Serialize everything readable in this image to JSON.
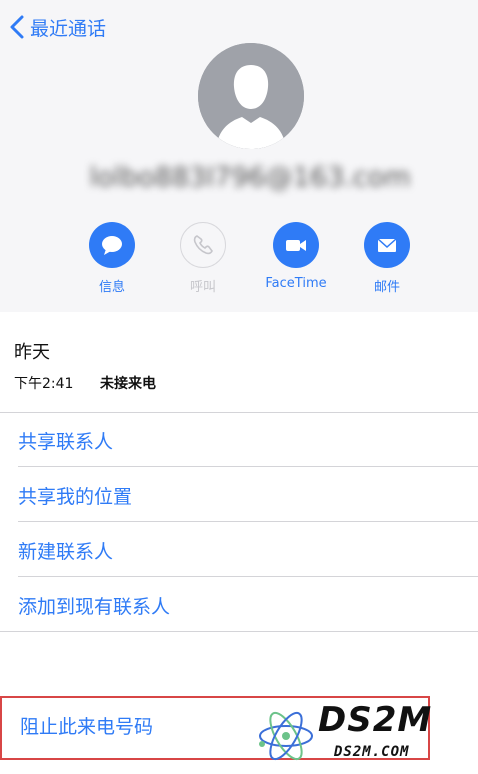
{
  "nav": {
    "back_label": "最近通话"
  },
  "contact": {
    "name": "lolbo883I796@163.com"
  },
  "actions": [
    {
      "label": "信息",
      "icon": "message-icon",
      "enabled": true
    },
    {
      "label": "呼叫",
      "icon": "phone-icon",
      "enabled": false
    },
    {
      "label": "FaceTime",
      "icon": "video-icon",
      "enabled": true
    },
    {
      "label": "邮件",
      "icon": "mail-icon",
      "enabled": true
    }
  ],
  "call_log": {
    "day": "昨天",
    "time": "下午2:41",
    "status": "未接来电"
  },
  "menu": [
    {
      "label": "共享联系人"
    },
    {
      "label": "共享我的位置"
    },
    {
      "label": "新建联系人"
    },
    {
      "label": "添加到现有联系人"
    }
  ],
  "block": {
    "label": "阻止此来电号码"
  },
  "watermark": {
    "logo": "DS2M",
    "site": "DS2M.COM"
  },
  "colors": {
    "accent": "#2f7bf6",
    "avatar": "#9fa2a9",
    "highlight": "#d84646"
  }
}
